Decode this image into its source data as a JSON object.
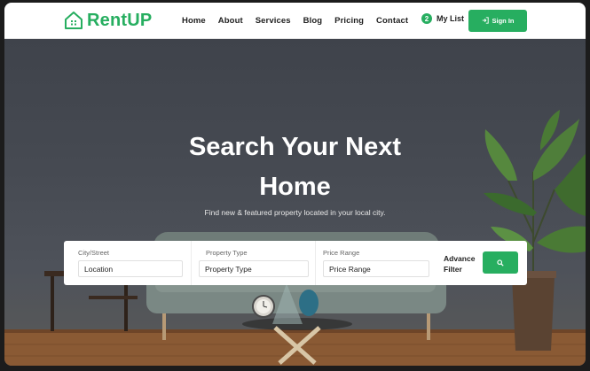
{
  "brand": {
    "name": "RentUP",
    "accent": "#27ae60"
  },
  "nav": {
    "items": [
      {
        "label": "Home"
      },
      {
        "label": "About"
      },
      {
        "label": "Services"
      },
      {
        "label": "Blog"
      },
      {
        "label": "Pricing"
      },
      {
        "label": "Contact"
      }
    ],
    "mylist": {
      "count": "2",
      "label": "My List"
    },
    "signin": {
      "label": "Sign In",
      "icon": "sign-in-icon"
    }
  },
  "hero": {
    "title_line1": "Search Your Next",
    "title_line2": "Home",
    "subtitle": "Find new & featured property located in your local city."
  },
  "search": {
    "fields": [
      {
        "label": "City/Street",
        "placeholder": "Location"
      },
      {
        "label": "Property Type",
        "placeholder": "Property Type"
      },
      {
        "label": "Price Range",
        "placeholder": "Price Range"
      }
    ],
    "advance_line1": "Advance",
    "advance_line2": "Filter",
    "button_icon": "search-icon"
  }
}
